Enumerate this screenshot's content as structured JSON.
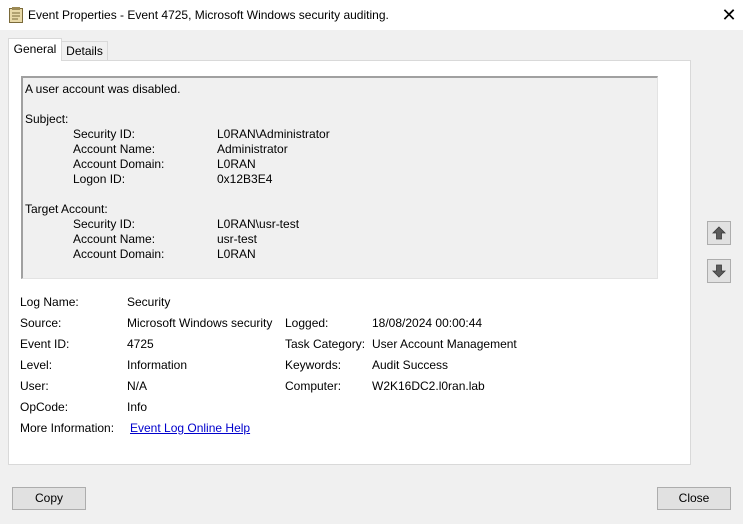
{
  "window": {
    "title": "Event Properties - Event 4725, Microsoft Windows security auditing.",
    "close_glyph": "✕"
  },
  "tabs": [
    {
      "label": "General",
      "active": true
    },
    {
      "label": "Details",
      "active": false
    }
  ],
  "description": {
    "headline": "A user account was disabled.",
    "subject_heading": "Subject:",
    "subject": [
      {
        "label": "Security ID:",
        "value": "L0RAN\\Administrator"
      },
      {
        "label": "Account Name:",
        "value": "Administrator"
      },
      {
        "label": "Account Domain:",
        "value": "L0RAN"
      },
      {
        "label": "Logon ID:",
        "value": "0x12B3E4"
      }
    ],
    "target_heading": "Target Account:",
    "target": [
      {
        "label": "Security ID:",
        "value": "L0RAN\\usr-test"
      },
      {
        "label": "Account Name:",
        "value": "usr-test"
      },
      {
        "label": "Account Domain:",
        "value": "L0RAN"
      }
    ]
  },
  "details": {
    "log_name_label": "Log Name:",
    "log_name": "Security",
    "source_label": "Source:",
    "source": "Microsoft Windows security",
    "logged_label": "Logged:",
    "logged": "18/08/2024 00:00:44",
    "event_id_label": "Event ID:",
    "event_id": "4725",
    "task_category_label": "Task Category:",
    "task_category": "User Account Management",
    "level_label": "Level:",
    "level": "Information",
    "keywords_label": "Keywords:",
    "keywords": "Audit Success",
    "user_label": "User:",
    "user": "N/A",
    "computer_label": "Computer:",
    "computer": "W2K16DC2.l0ran.lab",
    "opcode_label": "OpCode:",
    "opcode": "Info",
    "more_info_label": "More Information:",
    "more_info_link": "Event Log Online Help"
  },
  "buttons": {
    "copy": "Copy",
    "close": "Close",
    "up_icon": "arrow-up-icon",
    "down_icon": "arrow-down-icon"
  }
}
